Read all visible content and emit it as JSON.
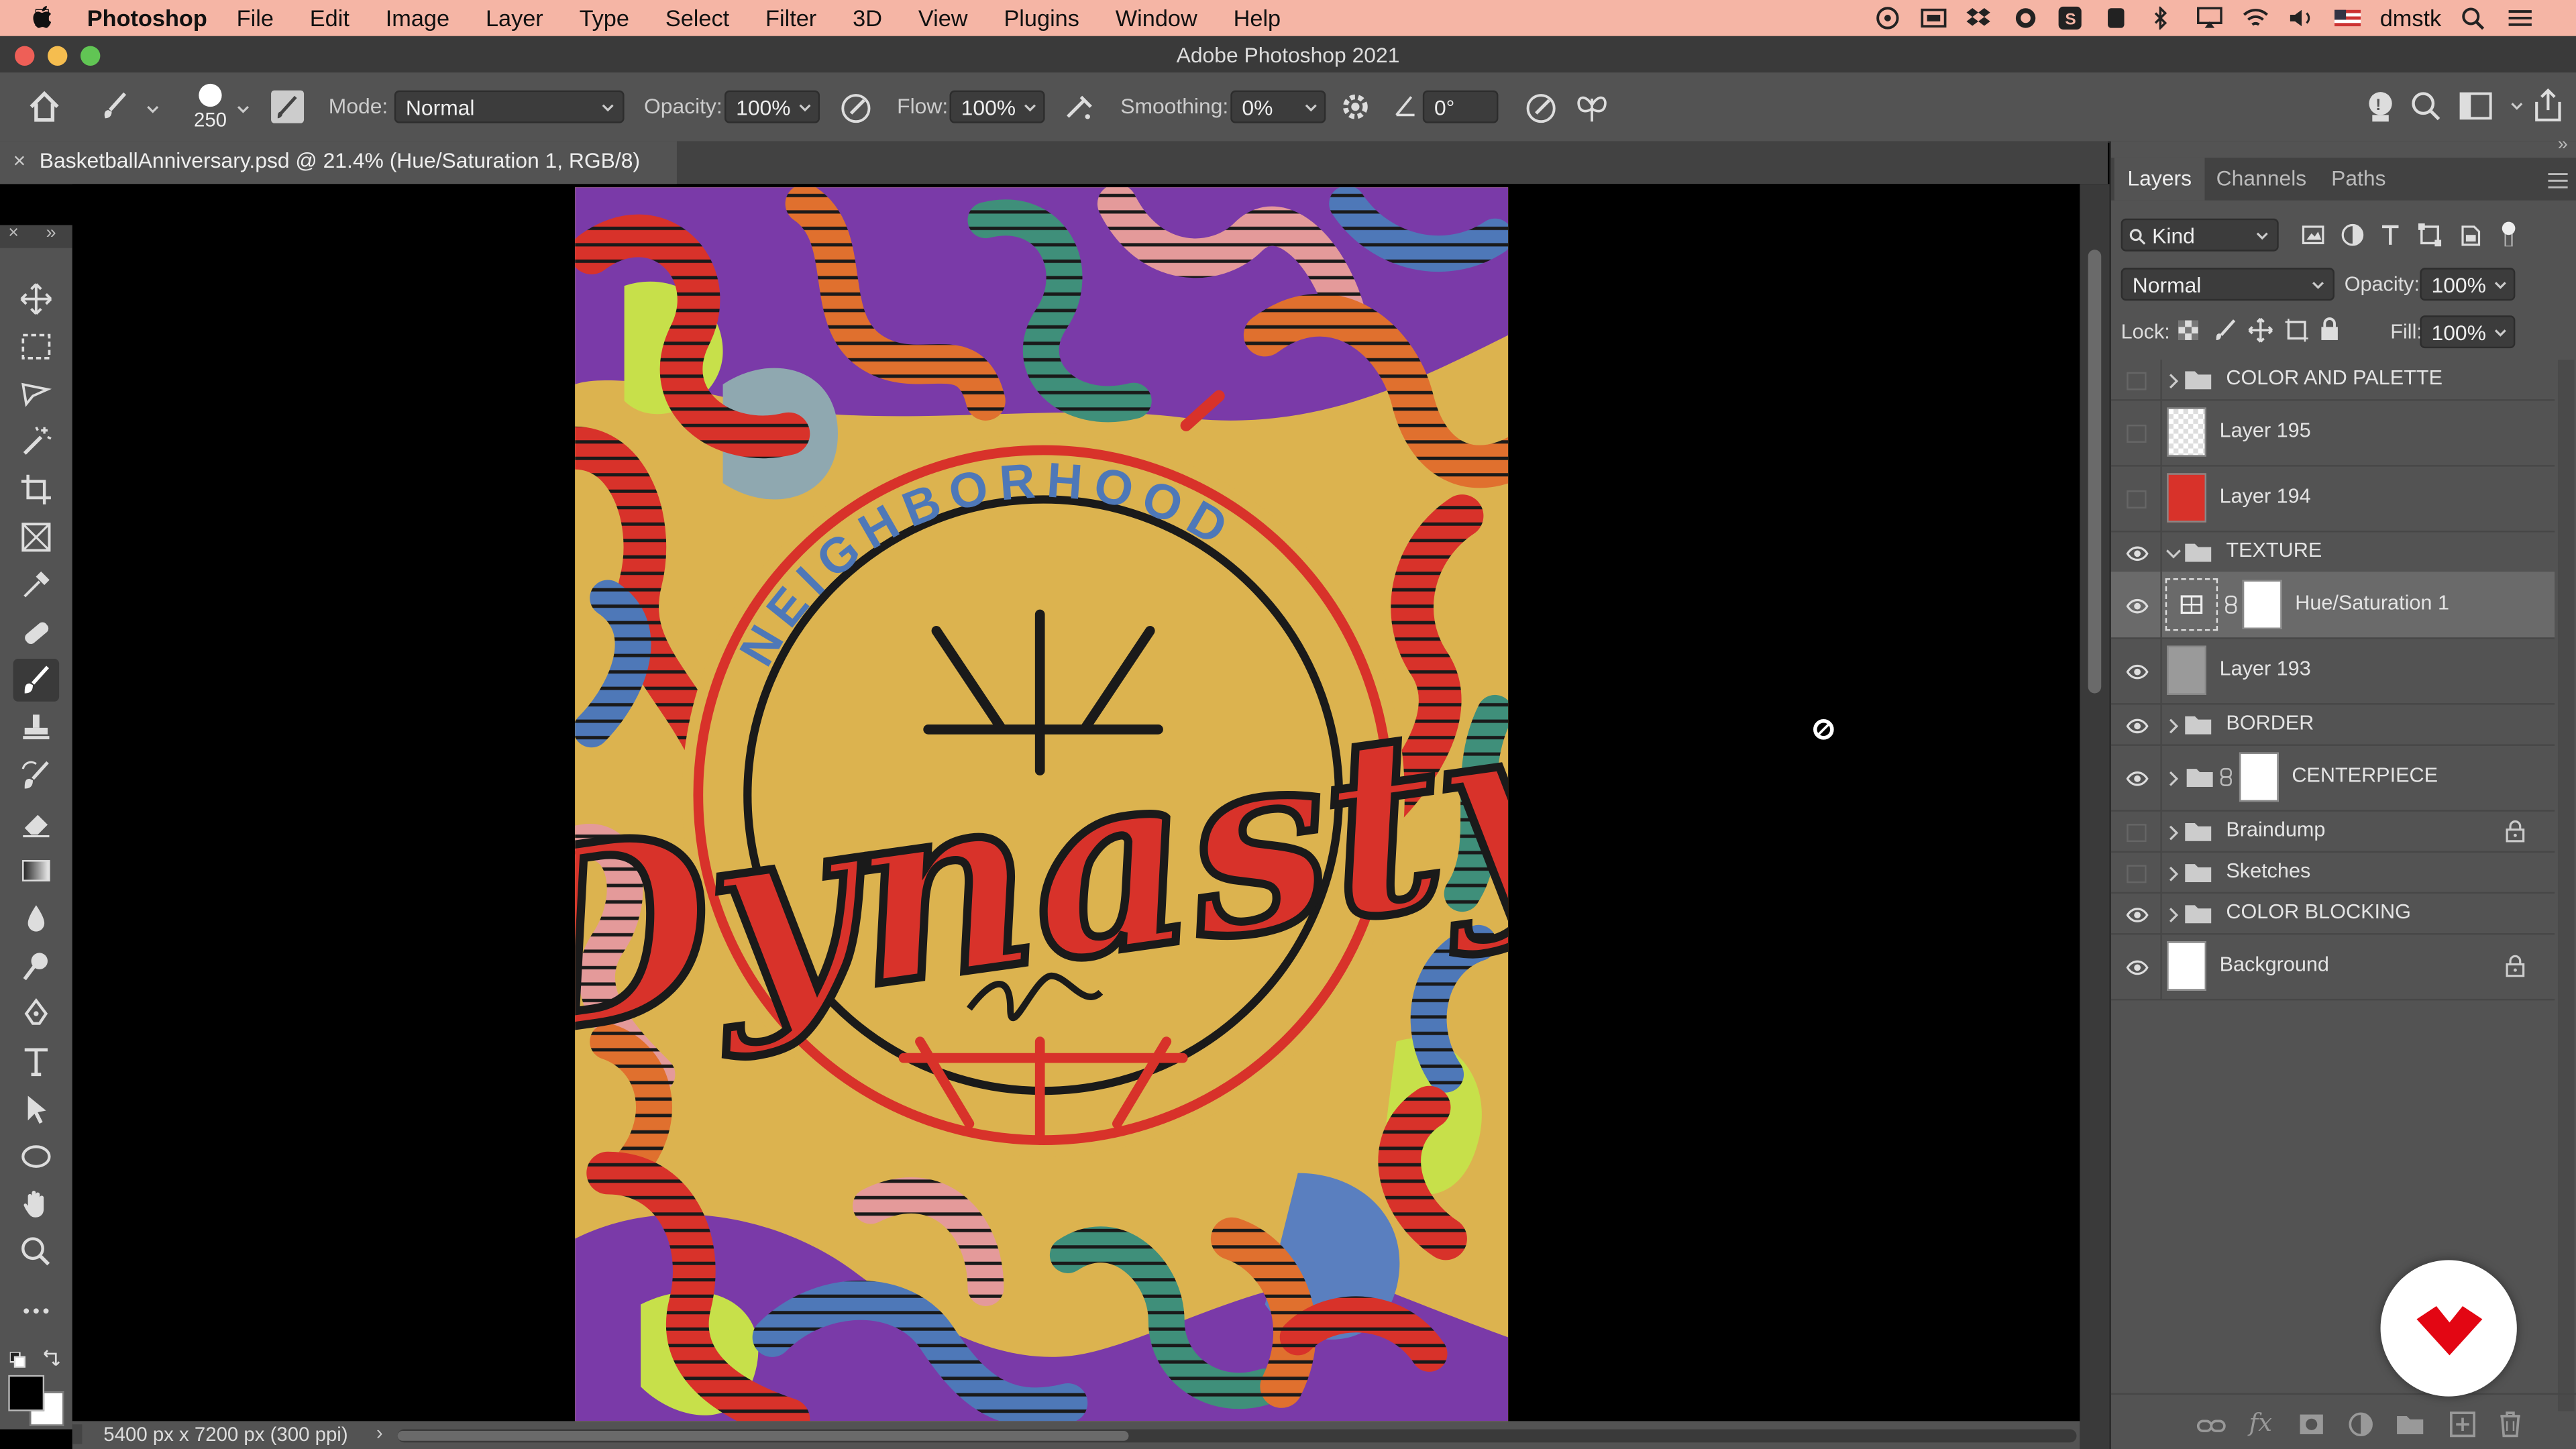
{
  "menubar": {
    "app_name": "Photoshop",
    "items": [
      "File",
      "Edit",
      "Image",
      "Layer",
      "Type",
      "Select",
      "Filter",
      "3D",
      "View",
      "Plugins",
      "Window",
      "Help"
    ],
    "user": "dmstk"
  },
  "window": {
    "title": "Adobe Photoshop 2021"
  },
  "options_bar": {
    "brush_size": "250",
    "mode_label": "Mode:",
    "mode_value": "Normal",
    "opacity_label": "Opacity:",
    "opacity_value": "100%",
    "flow_label": "Flow:",
    "flow_value": "100%",
    "smoothing_label": "Smoothing:",
    "smoothing_value": "0%",
    "angle_value": "0°"
  },
  "document": {
    "tab_title": "BasketballAnniversary.psd @ 21.4% (Hue/Saturation 1, RGB/8)",
    "tab_close": "×",
    "status_text": "5400 px x 7200 px (300 ppi)"
  },
  "artwork": {
    "arc_text": "NEIGHBORHOOD",
    "title": "Dynasty",
    "background_color": "#dcb34f",
    "accent_red": "#d8322a"
  },
  "panel": {
    "tabs": [
      "Layers",
      "Channels",
      "Paths"
    ],
    "filter_kind": "Kind",
    "blend_mode": "Normal",
    "opacity_label": "Opacity:",
    "opacity_value": "100%",
    "lock_label": "Lock:",
    "fill_label": "Fill:",
    "fill_value": "100%",
    "layers": [
      {
        "name": "COLOR AND PALETTE",
        "type": "group",
        "visible": false,
        "expanded": false
      },
      {
        "name": "Layer 195",
        "type": "layer",
        "visible": false
      },
      {
        "name": "Layer 194",
        "type": "layer",
        "visible": false
      },
      {
        "name": "TEXTURE",
        "type": "group",
        "visible": true,
        "expanded": true
      },
      {
        "name": "Hue/Saturation 1",
        "type": "adjustment",
        "visible": true,
        "selected": true
      },
      {
        "name": "Layer 193",
        "type": "layer",
        "visible": true
      },
      {
        "name": "BORDER",
        "type": "group",
        "visible": true,
        "expanded": false
      },
      {
        "name": "CENTERPIECE",
        "type": "group",
        "visible": true,
        "expanded": false
      },
      {
        "name": "Braindump",
        "type": "group",
        "visible": false,
        "locked": true
      },
      {
        "name": "Sketches",
        "type": "group",
        "visible": false
      },
      {
        "name": "COLOR BLOCKING",
        "type": "group",
        "visible": true
      },
      {
        "name": "Background",
        "type": "layer",
        "visible": true,
        "locked": true
      }
    ]
  }
}
